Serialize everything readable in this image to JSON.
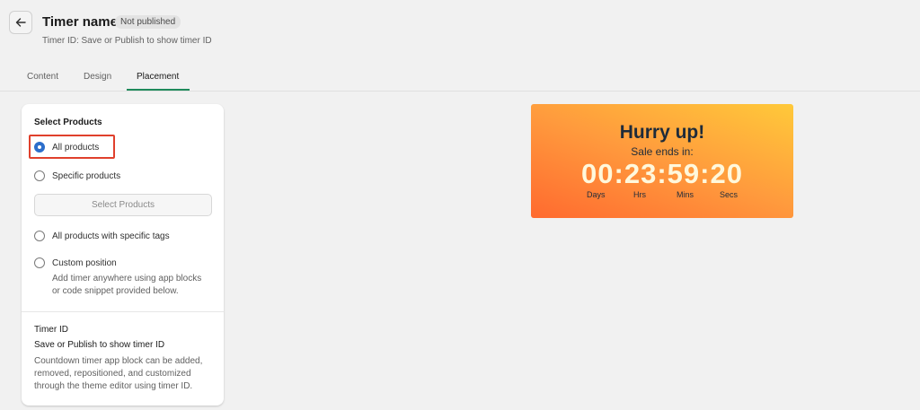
{
  "header": {
    "title": "Timer name",
    "status_badge": "Not published",
    "subtitle": "Timer ID: Save or Publish to show timer ID",
    "back_icon": "arrow-left-icon"
  },
  "tabs": [
    {
      "label": "Content",
      "active": false
    },
    {
      "label": "Design",
      "active": false
    },
    {
      "label": "Placement",
      "active": true
    }
  ],
  "placement": {
    "section_title": "Select Products",
    "options": [
      {
        "label": "All products",
        "selected": true
      },
      {
        "label": "Specific products",
        "selected": false
      },
      {
        "label": "All products with specific tags",
        "selected": false
      },
      {
        "label": "Custom position",
        "selected": false
      }
    ],
    "select_products_button": "Select Products",
    "custom_position_help": [
      "Add timer anywhere using app blocks",
      "or code snippet provided below."
    ],
    "timer_id": {
      "title": "Timer ID",
      "value": "Save or Publish to show timer ID",
      "description": "Countdown timer app block can be added, removed, repositioned, and customized through the theme editor using timer ID."
    }
  },
  "preview": {
    "heading": "Hurry up!",
    "subheading": "Sale ends in:",
    "countdown": "00:23:59:20",
    "units": [
      "Days",
      "Hrs",
      "Mins",
      "Secs"
    ]
  },
  "colors": {
    "accent": "#2c6ecb",
    "tab_underline": "#1f8a5b",
    "highlight": "#e0402c",
    "timer_gradient_start": "#ffc93a",
    "timer_gradient_end": "#ff6a2f"
  }
}
